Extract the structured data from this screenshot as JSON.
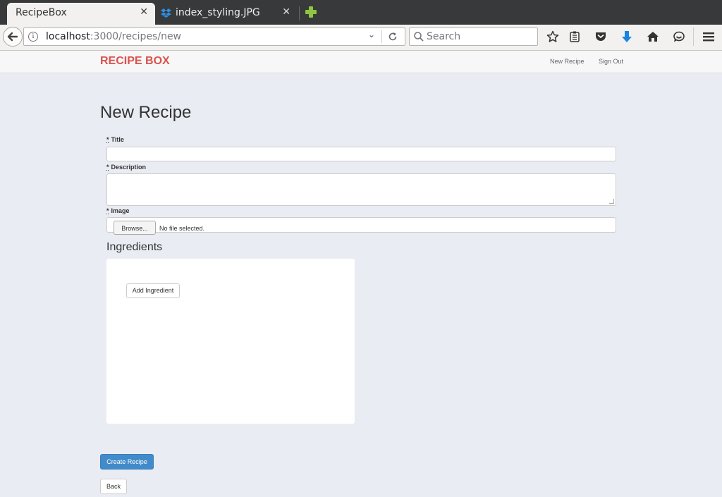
{
  "browser": {
    "tabs": [
      {
        "title": "RecipeBox"
      },
      {
        "title": "index_styling.JPG"
      }
    ],
    "url_host": "localhost",
    "url_path": ":3000/recipes/new",
    "search_placeholder": "Search"
  },
  "site": {
    "brand": "RECIPE BOX",
    "nav": [
      "New Recipe",
      "Sign Out"
    ]
  },
  "form": {
    "heading": "New Recipe",
    "required_marker": "*",
    "title_label": "Title",
    "description_label": "Description",
    "image_label": "Image",
    "browse_label": "Browse...",
    "no_file_text": "No file selected.",
    "ingredients_heading": "Ingredients",
    "add_ingredient_label": "Add Ingredient",
    "submit_label": "Create Recipe",
    "back_label": "Back"
  },
  "colors": {
    "brand": "#d9534f",
    "primary": "#428bca",
    "page_bg": "#e9ecf2"
  }
}
